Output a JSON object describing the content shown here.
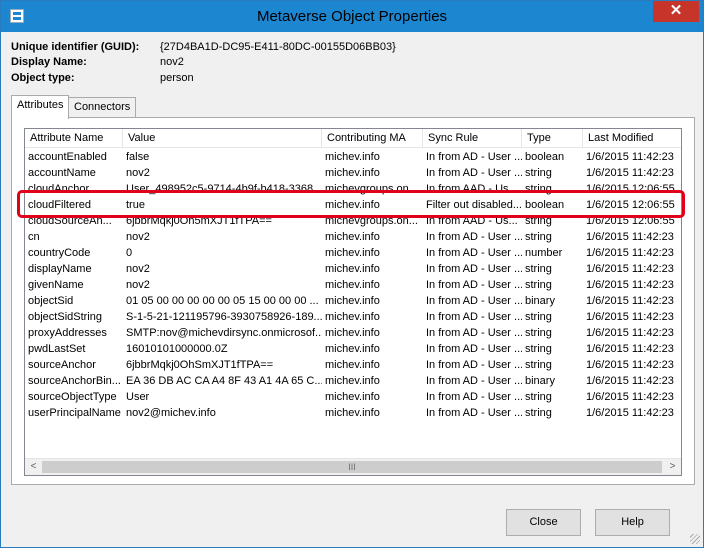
{
  "window": {
    "title": "Metaverse Object Properties",
    "close_glyph": "✕"
  },
  "info": [
    {
      "label": "Unique identifier (GUID):",
      "value": "{27D4BA1D-DC95-E411-80DC-00155D06BB03}"
    },
    {
      "label": "Display Name:",
      "value": "nov2"
    },
    {
      "label": "Object type:",
      "value": "person"
    }
  ],
  "tabs": [
    {
      "label": "Attributes",
      "active": true
    },
    {
      "label": "Connectors",
      "active": false
    }
  ],
  "table": {
    "columns": [
      "Attribute Name",
      "Value",
      "Contributing MA",
      "Sync Rule",
      "Type",
      "Last Modified"
    ],
    "rows": [
      [
        "accountEnabled",
        "false",
        "michev.info",
        "In from AD - User ...",
        "boolean",
        "1/6/2015 11:42:23"
      ],
      [
        "accountName",
        "nov2",
        "michev.info",
        "In from AD - User ...",
        "string",
        "1/6/2015 11:42:23"
      ],
      [
        "cloudAnchor",
        "User_498952c5-9714-4b9f-b418-3368...",
        "michevgroups.on...",
        "In from AAD - Us...",
        "string",
        "1/6/2015 12:06:55"
      ],
      [
        "cloudFiltered",
        "true",
        "michev.info",
        "Filter out disabled...",
        "boolean",
        "1/6/2015 12:06:55"
      ],
      [
        "cloudSourceAn...",
        "6jbbrMqkj0Oh5mXJT1fTPA==",
        "michevgroups.on...",
        "In from AAD - Us...",
        "string",
        "1/6/2015 12:06:55"
      ],
      [
        "cn",
        "nov2",
        "michev.info",
        "In from AD - User ...",
        "string",
        "1/6/2015 11:42:23"
      ],
      [
        "countryCode",
        "0",
        "michev.info",
        "In from AD - User ...",
        "number",
        "1/6/2015 11:42:23"
      ],
      [
        "displayName",
        "nov2",
        "michev.info",
        "In from AD - User ...",
        "string",
        "1/6/2015 11:42:23"
      ],
      [
        "givenName",
        "nov2",
        "michev.info",
        "In from AD - User ...",
        "string",
        "1/6/2015 11:42:23"
      ],
      [
        "objectSid",
        "01 05 00 00 00 00 00 05 15 00 00 00 ...",
        "michev.info",
        "In from AD - User ...",
        "binary",
        "1/6/2015 11:42:23"
      ],
      [
        "objectSidString",
        "S-1-5-21-121195796-3930758926-189...",
        "michev.info",
        "In from AD - User ...",
        "string",
        "1/6/2015 11:42:23"
      ],
      [
        "proxyAddresses",
        "SMTP:nov@michevdirsync.onmicrosof...",
        "michev.info",
        "In from AD - User ...",
        "string",
        "1/6/2015 11:42:23"
      ],
      [
        "pwdLastSet",
        "16010101000000.0Z",
        "michev.info",
        "In from AD - User ...",
        "string",
        "1/6/2015 11:42:23"
      ],
      [
        "sourceAnchor",
        "6jbbrMqkj0OhSmXJT1fTPA==",
        "michev.info",
        "In from AD - User ...",
        "string",
        "1/6/2015 11:42:23"
      ],
      [
        "sourceAnchorBin...",
        "EA 36 DB AC CA A4 8F 43 A1 4A 65 C...",
        "michev.info",
        "In from AD - User ...",
        "binary",
        "1/6/2015 11:42:23"
      ],
      [
        "sourceObjectType",
        "User",
        "michev.info",
        "In from AD - User ...",
        "string",
        "1/6/2015 11:42:23"
      ],
      [
        "userPrincipalName",
        "nov2@michev.info",
        "michev.info",
        "In from AD - User ...",
        "string",
        "1/6/2015 11:42:23"
      ]
    ]
  },
  "scrollbar": {
    "left_arrow": "<",
    "right_arrow": ">",
    "thumb_grip": "III"
  },
  "buttons": {
    "close": "Close",
    "help": "Help"
  },
  "colors": {
    "titlebar": "#1c86d1",
    "highlight": "#e0001a"
  }
}
